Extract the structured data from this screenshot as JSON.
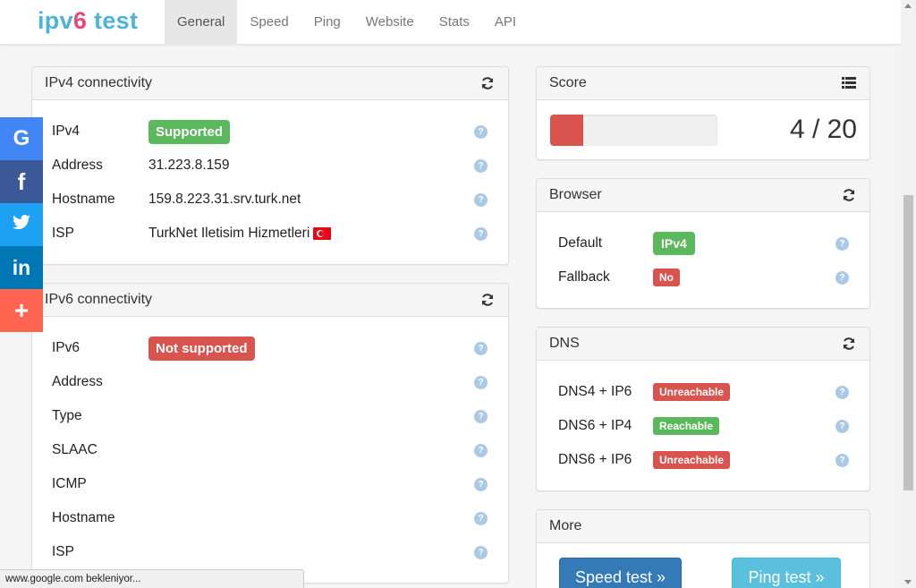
{
  "brand": {
    "part1": "ipv",
    "part2": "6",
    "part3": " test"
  },
  "nav": {
    "items": [
      "General",
      "Speed",
      "Ping",
      "Website",
      "Stats",
      "API"
    ],
    "active": "General"
  },
  "ipv4": {
    "title": "IPv4 connectivity",
    "rows": [
      {
        "label": "IPv4",
        "value": "Supported"
      },
      {
        "label": "Address",
        "value": "31.223.8.159"
      },
      {
        "label": "Hostname",
        "value": "159.8.223.31.srv.turk.net"
      },
      {
        "label": "ISP",
        "value": "TurkNet Iletisim Hizmetleri"
      }
    ]
  },
  "ipv6": {
    "title": "IPv6 connectivity",
    "rows": [
      {
        "label": "IPv6",
        "value": "Not supported"
      },
      {
        "label": "Address",
        "value": ""
      },
      {
        "label": "Type",
        "value": ""
      },
      {
        "label": "SLAAC",
        "value": ""
      },
      {
        "label": "ICMP",
        "value": ""
      },
      {
        "label": "Hostname",
        "value": ""
      },
      {
        "label": "ISP",
        "value": ""
      }
    ]
  },
  "score": {
    "title": "Score",
    "text": "4 / 20",
    "fraction": 0.2
  },
  "browser": {
    "title": "Browser",
    "rows": [
      {
        "label": "Default",
        "value": "IPv4"
      },
      {
        "label": "Fallback",
        "value": "No"
      }
    ]
  },
  "dns": {
    "title": "DNS",
    "rows": [
      {
        "label": "DNS4 + IP6",
        "value": "Unreachable"
      },
      {
        "label": "DNS6 + IP4",
        "value": "Reachable"
      },
      {
        "label": "DNS6 + IP6",
        "value": "Unreachable"
      }
    ]
  },
  "more": {
    "title": "More",
    "speed_button": "Speed test »",
    "ping_button": "Ping test »"
  },
  "help_glyph": "?",
  "social": {
    "google": "G",
    "facebook": "f",
    "twitter": "twitter-bird",
    "linkedin": "in",
    "more": "+"
  },
  "status_bar": "www.google.com bekleniyor...",
  "colors": {
    "success": "#5cb85c",
    "danger": "#d9534f",
    "primary": "#337ab7",
    "info": "#5bc0de",
    "google": "#4285f4",
    "facebook": "#3b5998",
    "twitter": "#1da1f2",
    "linkedin": "#0077b5",
    "share": "#ff6550"
  }
}
